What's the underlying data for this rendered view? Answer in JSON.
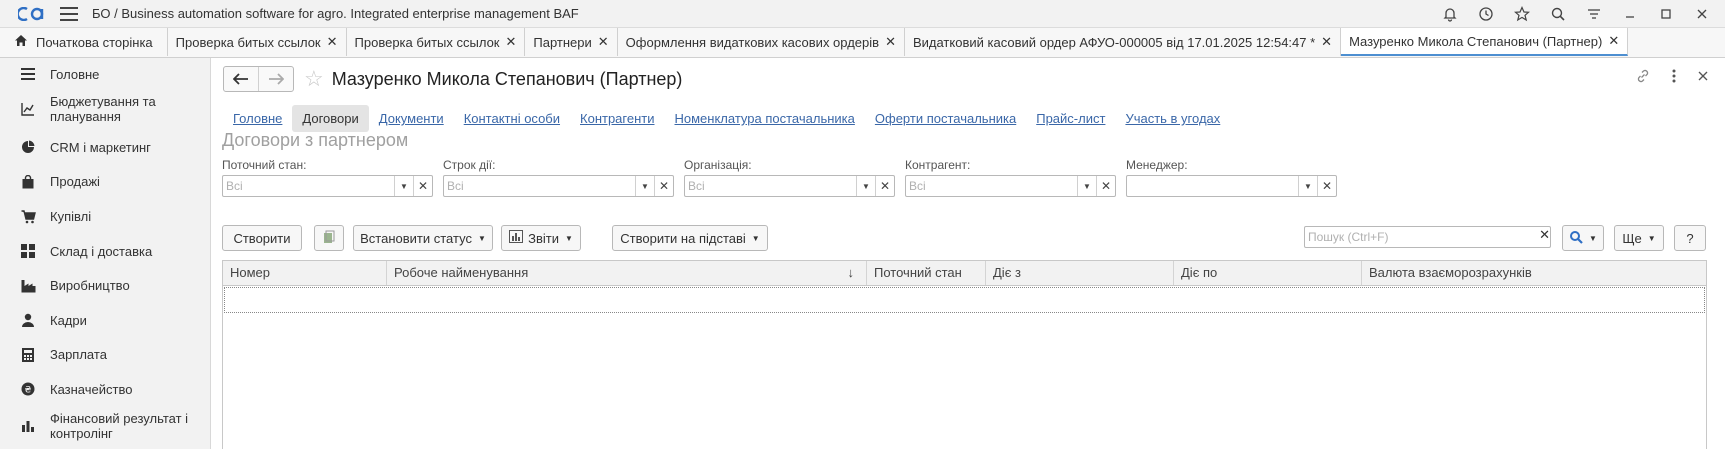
{
  "app": {
    "title": "БО / Business automation software for agro. Integrated enterprise management BAF"
  },
  "tabs": [
    {
      "label": "Початкова сторінка",
      "home": true
    },
    {
      "label": "Проверка битых ссылок",
      "closable": true
    },
    {
      "label": "Проверка битых ссылок",
      "closable": true
    },
    {
      "label": "Партнери",
      "closable": true
    },
    {
      "label": "Оформлення видаткових касових ордерів",
      "closable": true
    },
    {
      "label": "Видатковий касовий ордер АФУО-000005 від 17.01.2025 12:54:47 *",
      "closable": true
    },
    {
      "label": "Мазуренко Микола Степанович (Партнер)",
      "closable": true,
      "active": true
    }
  ],
  "sidebar": {
    "items": [
      {
        "label": "Головне",
        "icon": "list-icon"
      },
      {
        "label": "Бюджетування та планування",
        "icon": "chart-line-icon"
      },
      {
        "label": "CRM і маркетинг",
        "icon": "pie-chart-icon"
      },
      {
        "label": "Продажі",
        "icon": "shopping-bag-icon"
      },
      {
        "label": "Купівлі",
        "icon": "cart-icon"
      },
      {
        "label": "Склад і доставка",
        "icon": "grid-icon"
      },
      {
        "label": "Виробництво",
        "icon": "factory-icon"
      },
      {
        "label": "Кадри",
        "icon": "person-icon"
      },
      {
        "label": "Зарплата",
        "icon": "calculator-icon"
      },
      {
        "label": "Казначейство",
        "icon": "money-icon"
      },
      {
        "label": "Фінансовий результат і контролінг",
        "icon": "bar-chart-icon"
      }
    ]
  },
  "document": {
    "title": "Мазуренко Микола Степанович (Партнер)",
    "sections": [
      "Головне",
      "Договори",
      "Документи",
      "Контактні особи",
      "Контрагенти",
      "Номенклатура постачальника",
      "Оферти постачальника",
      "Прайс-лист",
      "Участь в угодах"
    ],
    "active_section": "Договори",
    "section_title": "Договори з партнером"
  },
  "filters": {
    "state": {
      "label": "Поточний стан:",
      "value": "Всі"
    },
    "term": {
      "label": "Строк дії:",
      "value": "Всі"
    },
    "org": {
      "label": "Організація:",
      "value": "Всі"
    },
    "counterparty": {
      "label": "Контрагент:",
      "value": "Всі"
    },
    "manager": {
      "label": "Менеджер:",
      "value": ""
    }
  },
  "commands": {
    "create": "Створити",
    "set_status": "Встановити статус",
    "reports": "Звіти",
    "create_based": "Створити на підставі",
    "search_placeholder": "Пошук (Ctrl+F)",
    "more": "Ще",
    "help": "?"
  },
  "grid": {
    "columns": [
      "Номер",
      "Робоче найменування",
      "Поточний стан",
      "Діє з",
      "Діє по",
      "Валюта взаєморозрахунків"
    ],
    "rows": []
  },
  "colors": {
    "accent": "#4d8fd1",
    "link": "#3a67a8",
    "logo": "#2f6fc4"
  }
}
